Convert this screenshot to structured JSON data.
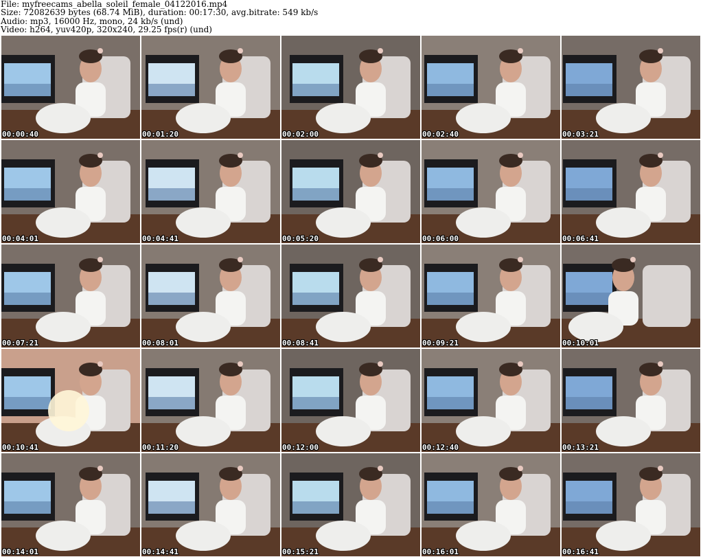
{
  "header": {
    "file_line": "File: myfreecams_abella_soleil_female_04122016.mp4",
    "size_line": "Size: 72082639 bytes (68.74 MiB), duration: 00:17:30, avg.bitrate: 549 kb/s",
    "audio_line": "Audio: mp3, 16000 Hz, mono, 24 kb/s (und)",
    "video_line": "Video: h264, yuv420p, 320x240, 29.25 fps(r) (und)"
  },
  "thumbnails": [
    {
      "timestamp": "00:00:40"
    },
    {
      "timestamp": "00:01:20"
    },
    {
      "timestamp": "00:02:00"
    },
    {
      "timestamp": "00:02:40"
    },
    {
      "timestamp": "00:03:21"
    },
    {
      "timestamp": "00:04:01"
    },
    {
      "timestamp": "00:04:41"
    },
    {
      "timestamp": "00:05:20"
    },
    {
      "timestamp": "00:06:00"
    },
    {
      "timestamp": "00:06:41"
    },
    {
      "timestamp": "00:07:21"
    },
    {
      "timestamp": "00:08:01"
    },
    {
      "timestamp": "00:08:41"
    },
    {
      "timestamp": "00:09:21"
    },
    {
      "timestamp": "00:10:01"
    },
    {
      "timestamp": "00:10:41"
    },
    {
      "timestamp": "00:11:20"
    },
    {
      "timestamp": "00:12:00"
    },
    {
      "timestamp": "00:12:40"
    },
    {
      "timestamp": "00:13:21"
    },
    {
      "timestamp": "00:14:01"
    },
    {
      "timestamp": "00:14:41"
    },
    {
      "timestamp": "00:15:21"
    },
    {
      "timestamp": "00:16:01"
    },
    {
      "timestamp": "00:16:41"
    }
  ]
}
